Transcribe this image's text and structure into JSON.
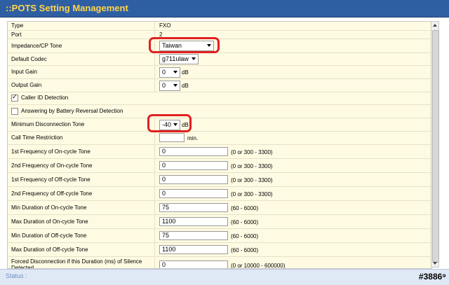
{
  "window_title": "::POTS Setting Management",
  "fields": {
    "type": {
      "label": "Type",
      "value": "FXO"
    },
    "port": {
      "label": "Port",
      "value": "2"
    },
    "impedance": {
      "label": "Impedance/CP Tone",
      "value": "Taiwan"
    },
    "codec": {
      "label": "Default Codec",
      "value": "g711ulaw"
    },
    "input_gain": {
      "label": "Input Gain",
      "value": "0",
      "unit": "dB"
    },
    "output_gain": {
      "label": "Output Gain",
      "value": "0",
      "unit": "dB"
    },
    "caller_id": {
      "label": "Caller ID Detection",
      "checked": true
    },
    "battery_reversal": {
      "label": "Answering by Battery Reversal Detection",
      "checked": false
    },
    "min_disconnect": {
      "label": "Minimum Disconnection Tone",
      "value": "-40",
      "unit": "dB"
    },
    "call_time": {
      "label": "Call Time Restriction",
      "value": "",
      "unit": "min."
    },
    "freq1_on": {
      "label": "1st Frequency of On-cycle Tone",
      "value": "0",
      "range": "(0 or 300 - 3300)"
    },
    "freq2_on": {
      "label": "2nd Frequency of On-cycle Tone",
      "value": "0",
      "range": "(0 or 300 - 3300)"
    },
    "freq1_off": {
      "label": "1st Frequency of Off-cycle Tone",
      "value": "0",
      "range": "(0 or 300 - 3300)"
    },
    "freq2_off": {
      "label": "2nd Frequency of Off-cycle Tone",
      "value": "0",
      "range": "(0 or 300 - 3300)"
    },
    "min_on": {
      "label": "Min Duration of On-cycle Tone",
      "value": "75",
      "range": "(60 - 6000)"
    },
    "max_on": {
      "label": "Max Duration of On-cycle Tone",
      "value": "1100",
      "range": "(60 - 6000)"
    },
    "min_off": {
      "label": "Min Duration of Off-cycle Tone",
      "value": "75",
      "range": "(60 - 6000)"
    },
    "max_off": {
      "label": "Max Duration of Off-cycle Tone",
      "value": "1100",
      "range": "(60 - 6000)"
    },
    "forced_disconnect": {
      "label": "Forced Disconnection if this Duration (ms) of Silence Detected",
      "value": "0",
      "range": "(0 or 10000 - 600000)"
    }
  },
  "status_label": "Status :",
  "watermark": "#3886⁹",
  "colors": {
    "title_bg": "#2f5fa3",
    "title_text": "#ffd54a",
    "panel_bg": "#fffbe3",
    "highlight": "#e02020"
  }
}
